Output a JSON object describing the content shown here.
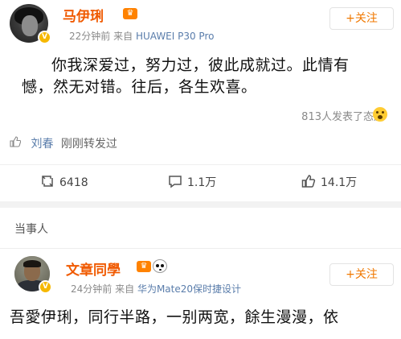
{
  "post1": {
    "username": "马伊琍",
    "verified_badge": "V",
    "vip_icon": "crown-icon",
    "time": "22分钟前",
    "source_prefix": "来自",
    "device": "HUAWEI P30 Pro",
    "follow_label": "+关注",
    "content_line1": "你我深爱过，努力过，彼此成就过。此情有",
    "content_line2": "憾，然无对错。往后，各生欢喜。",
    "reactions_text": "813人发表了态度",
    "reaction_icon": "surprised-emoji-icon",
    "repost": {
      "icon": "thumbs-up-icon",
      "user": "刘春",
      "text": "刚刚转发过"
    },
    "actions": {
      "repost_count": "6418",
      "comment_count": "1.1万",
      "like_count": "14.1万"
    }
  },
  "section": {
    "title": "当事人"
  },
  "post2": {
    "username": "文章同學",
    "verified_badge": "V",
    "vip_icon": "crown-icon",
    "panda_icon": "panda-icon",
    "time": "24分钟前",
    "source_prefix": "来自",
    "device": "华为Mate20保时捷设计",
    "follow_label": "+关注",
    "content_line1": "吾愛伊琍，同行半路，一别两宽，餘生漫漫，依"
  },
  "colors": {
    "username": "#f05a00",
    "follow": "#f07800",
    "link": "#5a7dab",
    "meta": "#8a8a8a"
  }
}
